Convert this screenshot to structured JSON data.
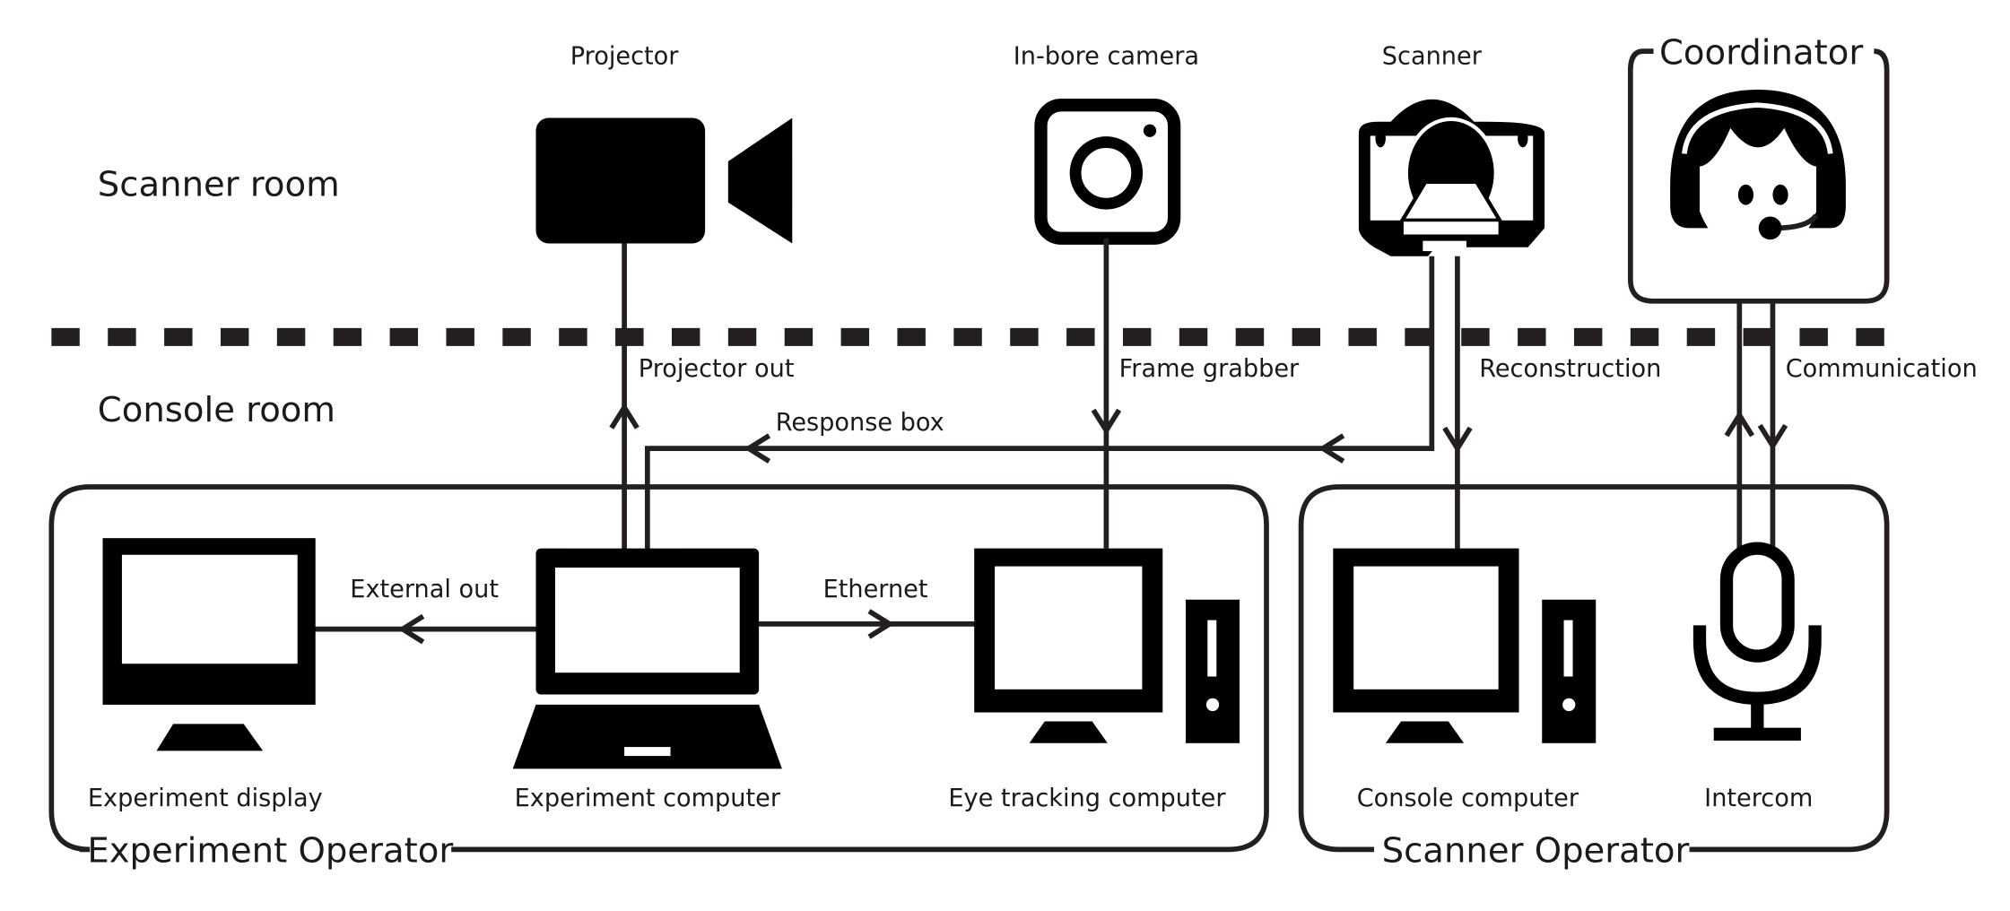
{
  "rooms": {
    "scanner_room": "Scanner room",
    "console_room": "Console room"
  },
  "devices": {
    "projector": "Projector",
    "in_bore_camera": "In-bore camera",
    "scanner": "Scanner",
    "coordinator": "Coordinator",
    "experiment_display": "Experiment display",
    "experiment_computer": "Experiment computer",
    "eye_tracking_computer": "Eye tracking computer",
    "console_computer": "Console computer",
    "intercom": "Intercom"
  },
  "connections": {
    "projector_out": "Projector out",
    "frame_grabber": "Frame grabber",
    "reconstruction": "Reconstruction",
    "communication": "Communication",
    "response_box": "Response box",
    "external_out": "External out",
    "ethernet": "Ethernet"
  },
  "groups": {
    "experiment_operator": "Experiment Operator",
    "scanner_operator": "Scanner Operator"
  }
}
